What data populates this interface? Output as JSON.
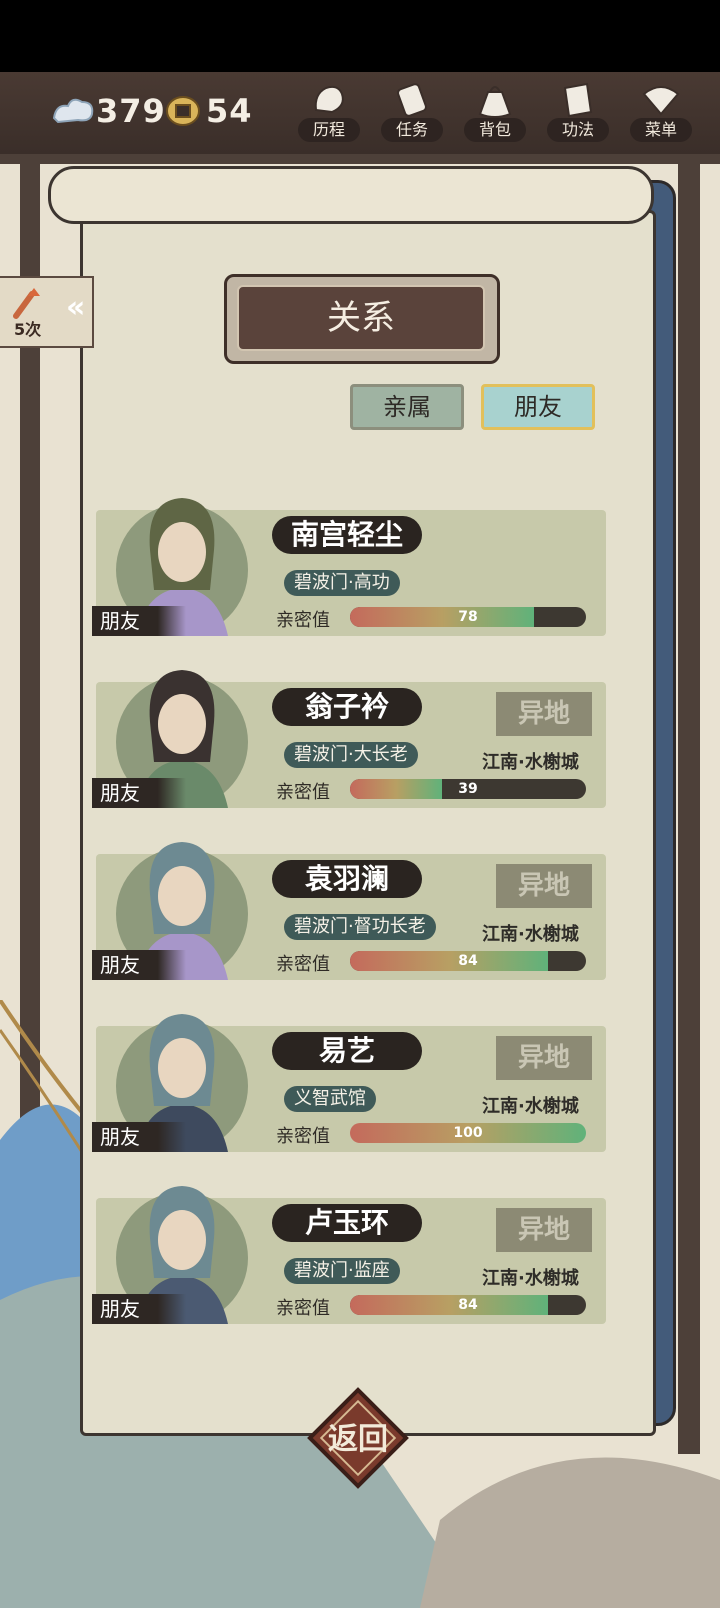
{
  "hud": {
    "currency1": "379",
    "currency2": "54",
    "buttons": [
      {
        "label": "历程",
        "icon": "journey-icon"
      },
      {
        "label": "任务",
        "icon": "task-icon"
      },
      {
        "label": "背包",
        "icon": "bag-icon"
      },
      {
        "label": "功法",
        "icon": "skill-book-icon"
      },
      {
        "label": "菜单",
        "icon": "menu-fan-icon"
      }
    ]
  },
  "side_tab": {
    "count": "5次"
  },
  "title": "关系",
  "tabs": {
    "family": "亲属",
    "friends": "朋友"
  },
  "intimacy_label": "亲密值",
  "friend_tag": "朋友",
  "away_label": "异地",
  "cards": [
    {
      "name": "南宫轻尘",
      "sect": "碧波门·高功",
      "intimacy": "78",
      "intimacy_value": 78,
      "away": "",
      "location": ""
    },
    {
      "name": "翁子衿",
      "sect": "碧波门·大长老",
      "intimacy": "39",
      "intimacy_value": 39,
      "away": "异地",
      "location": "江南·水榭城"
    },
    {
      "name": "袁羽澜",
      "sect": "碧波门·督功长老",
      "intimacy": "84",
      "intimacy_value": 84,
      "away": "异地",
      "location": "江南·水榭城"
    },
    {
      "name": "易艺",
      "sect": "义智武馆",
      "intimacy": "100",
      "intimacy_value": 100,
      "away": "异地",
      "location": "江南·水榭城"
    },
    {
      "name": "卢玉环",
      "sect": "碧波门·监座",
      "intimacy": "84",
      "intimacy_value": 84,
      "away": "异地",
      "location": "江南·水榭城"
    }
  ],
  "back_button": "返回",
  "colors": {
    "paper": "#e4e0cd",
    "card": "#c7c9aa",
    "dark": "#2a2420",
    "tab_active_border": "#e2c05b"
  }
}
